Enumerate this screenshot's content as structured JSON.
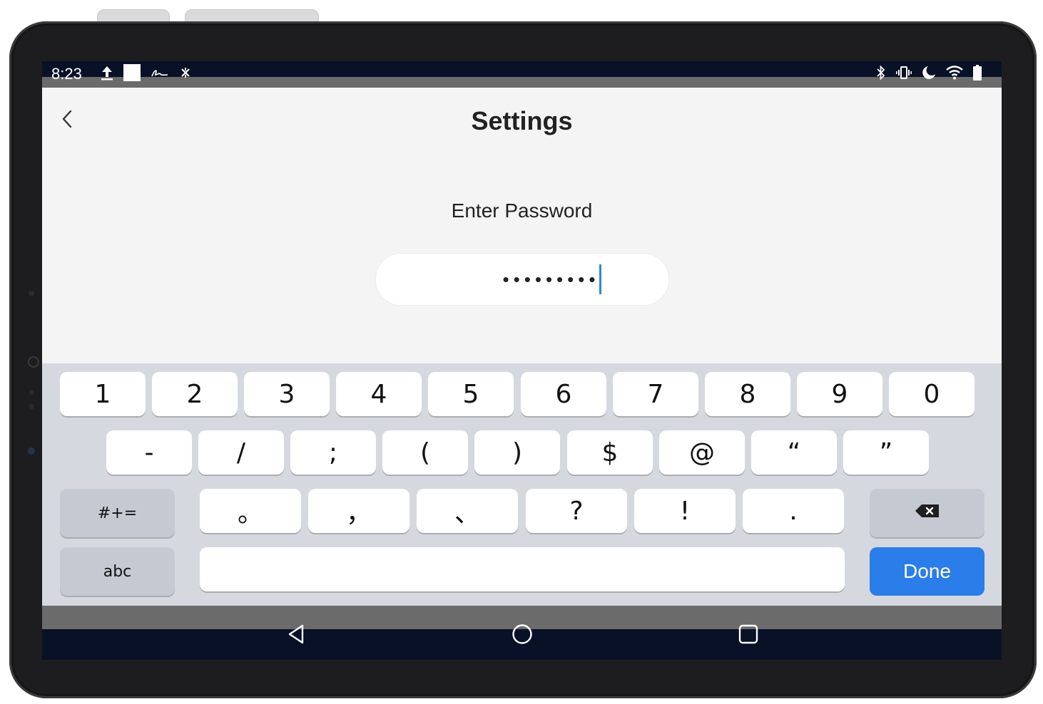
{
  "status_bar": {
    "time": "8:23",
    "left_icons": [
      "upload-icon",
      "square-notification-icon",
      "signature-icon",
      "no-data-icon"
    ],
    "right_icons": [
      "bluetooth-icon",
      "vibrate-icon",
      "do-not-disturb-icon",
      "wifi-icon",
      "battery-icon"
    ]
  },
  "app_bar": {
    "title": "Settings",
    "back_icon": "chevron-left-icon"
  },
  "password": {
    "prompt": "Enter Password",
    "masked_value": "•••••••••"
  },
  "keyboard": {
    "row1": [
      "1",
      "2",
      "3",
      "4",
      "5",
      "6",
      "7",
      "8",
      "9",
      "0"
    ],
    "row2": [
      "-",
      "/",
      ";",
      "(",
      ")",
      "$",
      "@",
      "“",
      "”"
    ],
    "row3": [
      "。",
      "，",
      "、",
      "?",
      "!",
      "."
    ],
    "symbols_key": "#+=",
    "abc_key": "abc",
    "done_key": "Done",
    "backspace_icon": "backspace-icon",
    "done_color": "#2b7de9"
  },
  "nav_bar": {
    "icons": [
      "back-triangle-icon",
      "home-circle-icon",
      "recents-square-icon"
    ]
  }
}
